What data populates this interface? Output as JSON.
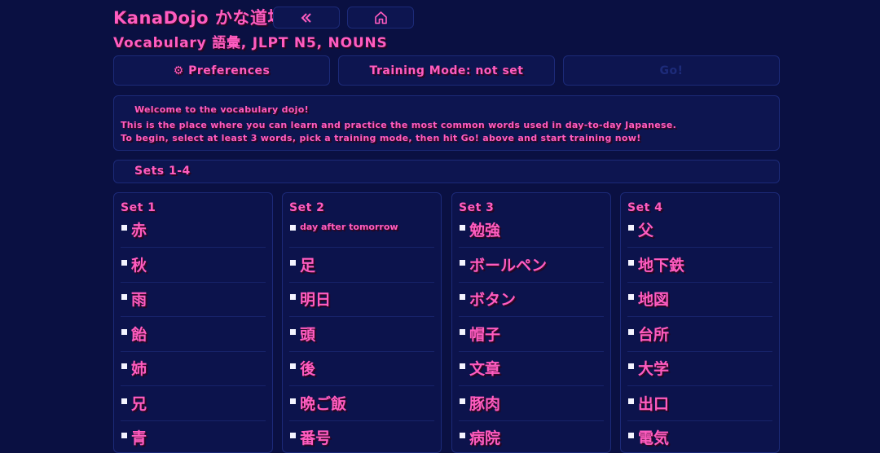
{
  "header": {
    "app_title": "KanaDojo かな道場",
    "subtitle": "Vocabulary 語彙, JLPT N5, NOUNS",
    "back_icon": "double-chevron-left-icon",
    "home_icon": "home-icon"
  },
  "toolbar": {
    "preferences_label": "⚙ Preferences",
    "training_mode_label": "Training Mode: not set",
    "go_label": "Go!"
  },
  "welcome": {
    "heading": "Welcome to the vocabulary dojo!",
    "line1": "This is the place where you can learn and practice the most common words used in day-to-day Japanese.",
    "line2": "To begin, select at least 3 words, pick a training mode, then hit Go! above and start training now!"
  },
  "sets_header": "Sets 1-4",
  "sets": [
    {
      "title": "Set 1",
      "words": [
        "赤",
        "秋",
        "雨",
        "飴",
        "姉",
        "兄",
        "青"
      ]
    },
    {
      "title": "Set 2",
      "words": [
        "day after tomorrow",
        "足",
        "明日",
        "頭",
        "後",
        "晩ご飯",
        "番号"
      ]
    },
    {
      "title": "Set 3",
      "words": [
        "勉強",
        "ボールペン",
        "ボタン",
        "帽子",
        "文章",
        "豚肉",
        "病院"
      ]
    },
    {
      "title": "Set 4",
      "words": [
        "父",
        "地下鉄",
        "地図",
        "台所",
        "大学",
        "出口",
        "電気"
      ]
    }
  ]
}
